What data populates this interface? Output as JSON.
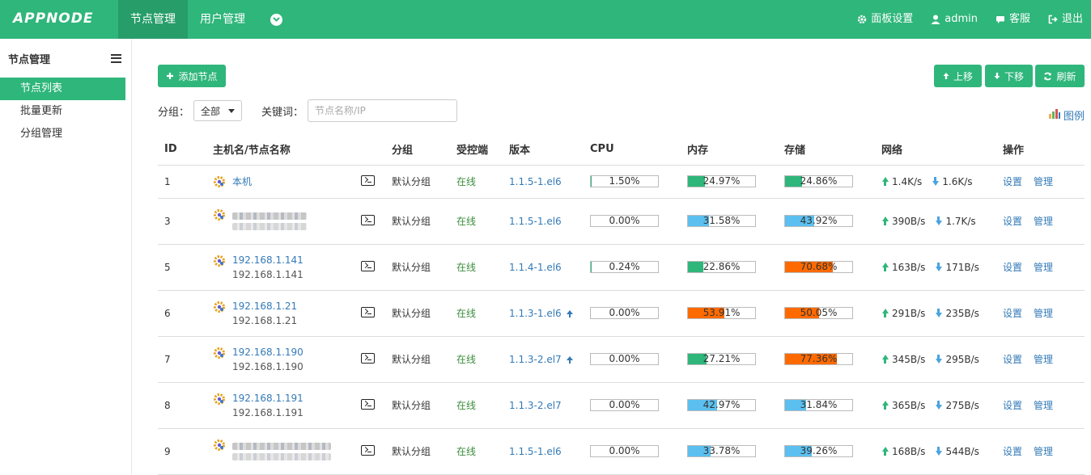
{
  "brand": "APPNODE",
  "nav": {
    "items": [
      "节点管理",
      "用户管理"
    ],
    "active": 0
  },
  "right_menu": {
    "settings": "面板设置",
    "user": "admin",
    "support": "客服",
    "logout": "退出"
  },
  "sidebar": {
    "title": "节点管理",
    "items": [
      {
        "label": "节点列表",
        "active": true
      },
      {
        "label": "批量更新",
        "active": false
      },
      {
        "label": "分组管理",
        "active": false
      }
    ]
  },
  "toolbar": {
    "add": "添加节点",
    "up": "上移",
    "down": "下移",
    "refresh": "刷新"
  },
  "filter": {
    "group_label": "分组：",
    "group_value": "全部",
    "keyword_label": "关键词：",
    "keyword_placeholder": "节点名称/IP"
  },
  "legend_link": "图例",
  "table": {
    "headers": [
      "ID",
      "主机名/节点名称",
      "",
      "分组",
      "受控端",
      "版本",
      "CPU",
      "内存",
      "存储",
      "网络",
      "操作"
    ],
    "rows": [
      {
        "id": "1",
        "name": "本机",
        "sub": "",
        "blurred": false,
        "group": "默认分组",
        "status": "在线",
        "version": "1.1.5-1.el6",
        "upgrade": false,
        "cpu": "1.50%",
        "cpu_pct": 1.5,
        "mem": "24.97%",
        "mem_pct": 24.97,
        "mem_color": "#2fb67b",
        "disk": "24.86%",
        "disk_pct": 24.86,
        "disk_color": "#2fb67b",
        "up": "1.4K/s",
        "down": "1.6K/s",
        "op1": "设置",
        "op2": "管理"
      },
      {
        "id": "3",
        "name": "",
        "sub": "",
        "blurred": true,
        "group": "默认分组",
        "status": "在线",
        "version": "1.1.5-1.el6",
        "upgrade": false,
        "cpu": "0.00%",
        "cpu_pct": 0,
        "mem": "31.58%",
        "mem_pct": 31.58,
        "mem_color": "#5bc0f0",
        "disk": "43.92%",
        "disk_pct": 43.92,
        "disk_color": "#5bc0f0",
        "up": "390B/s",
        "down": "1.7K/s",
        "op1": "设置",
        "op2": "管理"
      },
      {
        "id": "5",
        "name": "192.168.1.141",
        "sub": "192.168.1.141",
        "blurred": false,
        "group": "默认分组",
        "status": "在线",
        "version": "1.1.4-1.el6",
        "upgrade": false,
        "cpu": "0.24%",
        "cpu_pct": 0.24,
        "mem": "22.86%",
        "mem_pct": 22.86,
        "mem_color": "#2fb67b",
        "disk": "70.68%",
        "disk_pct": 70.68,
        "disk_color": "#ff6a00",
        "up": "163B/s",
        "down": "171B/s",
        "op1": "设置",
        "op2": "管理"
      },
      {
        "id": "6",
        "name": "192.168.1.21",
        "sub": "192.168.1.21",
        "blurred": false,
        "group": "默认分组",
        "status": "在线",
        "version": "1.1.3-1.el6",
        "upgrade": true,
        "cpu": "0.00%",
        "cpu_pct": 0,
        "mem": "53.91%",
        "mem_pct": 53.91,
        "mem_color": "#ff6a00",
        "disk": "50.05%",
        "disk_pct": 50.05,
        "disk_color": "#ff6a00",
        "up": "291B/s",
        "down": "235B/s",
        "op1": "设置",
        "op2": "管理"
      },
      {
        "id": "7",
        "name": "192.168.1.190",
        "sub": "192.168.1.190",
        "blurred": false,
        "group": "默认分组",
        "status": "在线",
        "version": "1.1.3-2.el7",
        "upgrade": true,
        "cpu": "0.00%",
        "cpu_pct": 0,
        "mem": "27.21%",
        "mem_pct": 27.21,
        "mem_color": "#2fb67b",
        "disk": "77.36%",
        "disk_pct": 77.36,
        "disk_color": "#ff6a00",
        "up": "345B/s",
        "down": "295B/s",
        "op1": "设置",
        "op2": "管理"
      },
      {
        "id": "8",
        "name": "192.168.1.191",
        "sub": "192.168.1.191",
        "blurred": false,
        "group": "默认分组",
        "status": "在线",
        "version": "1.1.3-2.el7",
        "upgrade": false,
        "cpu": "0.00%",
        "cpu_pct": 0,
        "mem": "42.97%",
        "mem_pct": 42.97,
        "mem_color": "#5bc0f0",
        "disk": "31.84%",
        "disk_pct": 31.84,
        "disk_color": "#5bc0f0",
        "up": "365B/s",
        "down": "275B/s",
        "op1": "设置",
        "op2": "管理"
      },
      {
        "id": "9",
        "name": "",
        "sub": "",
        "blurred": true,
        "group": "默认分组",
        "status": "在线",
        "version": "1.1.5-1.el6",
        "upgrade": false,
        "cpu": "0.00%",
        "cpu_pct": 0,
        "mem": "33.78%",
        "mem_pct": 33.78,
        "mem_color": "#5bc0f0",
        "disk": "39.26%",
        "disk_pct": 39.26,
        "disk_color": "#5bc0f0",
        "up": "168B/s",
        "down": "544B/s",
        "op1": "设置",
        "op2": "管理"
      }
    ]
  }
}
